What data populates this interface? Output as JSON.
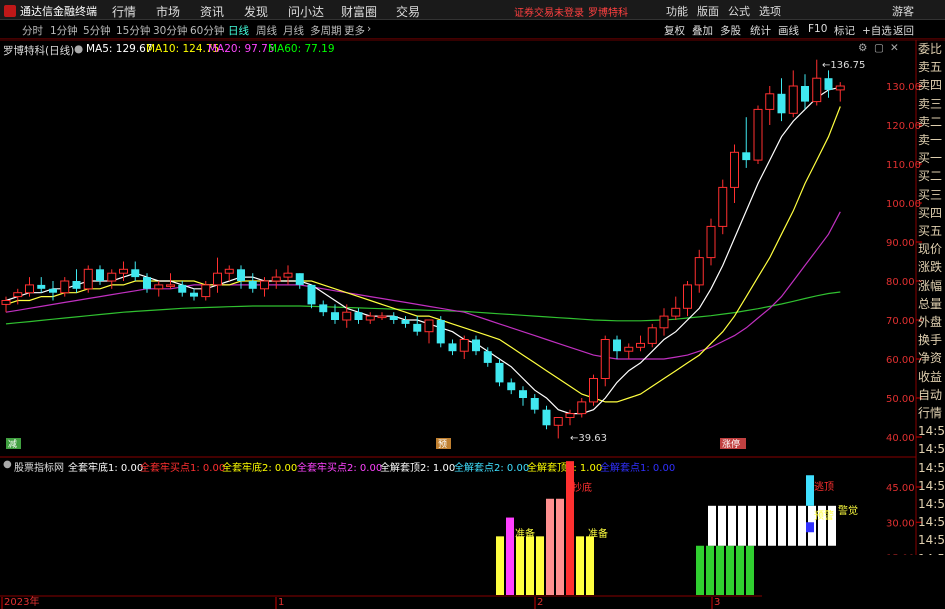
{
  "menubar": {
    "app_title": "通达信金融终端",
    "items": [
      "行情",
      "市场",
      "资讯",
      "发现",
      "问小达",
      "财富圈",
      "交易"
    ],
    "warning": "证券交易未登录",
    "stock": "罗博特科",
    "right_items": [
      "功能",
      "版面",
      "公式",
      "选项"
    ],
    "guest": "游客"
  },
  "periodbar": {
    "periods": [
      "分时",
      "1分钟",
      "5分钟",
      "15分钟",
      "30分钟",
      "60分钟",
      "日线",
      "周线",
      "月线",
      "多周期",
      "更多"
    ],
    "active": "日线",
    "tools": [
      "复权",
      "叠加",
      "多股",
      "统计",
      "画线",
      "F10",
      "标记",
      "+自选",
      "返回"
    ]
  },
  "info": {
    "title": "罗博特科(日线)",
    "ma5": "MA5: 129.67",
    "ma10": "MA10: 124.75",
    "ma20": "MA20: 97.75",
    "ma60": "MA60: 77.19",
    "colors": {
      "ma5": "#ffffff",
      "ma10": "#ffff00",
      "ma20": "#ff40ff",
      "ma60": "#00ff00"
    }
  },
  "right_panel": [
    "委比",
    "卖五",
    "卖四",
    "卖三",
    "卖二",
    "卖一",
    "买一",
    "买二",
    "买三",
    "买四",
    "买五",
    "现价",
    "涨跌",
    "涨幅",
    "总量",
    "外盘",
    "换手",
    "净资",
    "收益",
    "自动",
    "行情",
    "14:5",
    "14:5",
    "14:5",
    "14:5",
    "14:5",
    "14:5",
    "14:5",
    "14:5",
    "14:5",
    "14:5"
  ],
  "indicator": {
    "name": "股票指标网",
    "items": [
      {
        "text": "全套牢底1: 0.00",
        "color": "#ffffff"
      },
      {
        "text": "全套牢买点1: 0.00",
        "color": "#ff3030"
      },
      {
        "text": "全套牢底2: 0.00",
        "color": "#ffff00"
      },
      {
        "text": "全套牢买点2: 0.00",
        "color": "#ff40ff"
      },
      {
        "text": "全解套顶2: 1.00",
        "color": "#ffffff"
      },
      {
        "text": "全解套点2: 0.00",
        "color": "#40e0ff"
      },
      {
        "text": "全解套顶1: 1.00",
        "color": "#ffff00"
      },
      {
        "text": "全解套点1: 0.00",
        "color": "#3030ff"
      }
    ]
  },
  "chart_data": {
    "type": "candlestick",
    "price_ticks": [
      "130.00",
      "120.00",
      "110.00",
      "100.00",
      "90.00",
      "80.00",
      "70.00",
      "60.00",
      "50.00",
      "40.00"
    ],
    "high_label": "136.75",
    "low_label": "39.63",
    "ind_ticks": [
      "45.00",
      "30.00",
      "15.00"
    ],
    "x_labels": [
      "2023年",
      "1",
      "2",
      "3"
    ],
    "markers": [
      "减",
      "预",
      "涨停"
    ],
    "ind_labels": [
      "抄底",
      "准备",
      "准备",
      "逃顶",
      "预警",
      "警觉"
    ],
    "candles": [
      [
        74,
        76,
        72,
        75
      ],
      [
        76,
        78,
        74,
        77
      ],
      [
        77,
        81,
        76,
        79
      ],
      [
        79,
        81,
        77,
        78
      ],
      [
        78,
        80,
        75,
        77
      ],
      [
        77,
        81,
        76,
        80
      ],
      [
        80,
        83,
        77,
        78
      ],
      [
        78,
        84,
        77,
        83
      ],
      [
        83,
        84,
        79,
        80
      ],
      [
        80,
        83,
        78,
        82
      ],
      [
        82,
        85,
        80,
        83
      ],
      [
        83,
        85,
        80,
        81
      ],
      [
        81,
        82,
        77,
        78
      ],
      [
        78,
        80,
        76,
        79
      ],
      [
        79,
        82,
        78,
        79
      ],
      [
        79,
        80,
        76,
        77
      ],
      [
        77,
        78,
        75,
        76
      ],
      [
        76,
        80,
        75,
        79
      ],
      [
        79,
        86,
        77,
        82
      ],
      [
        82,
        84,
        80,
        83
      ],
      [
        83,
        84,
        78,
        80
      ],
      [
        80,
        82,
        77,
        78
      ],
      [
        78,
        81,
        76,
        80
      ],
      [
        80,
        83,
        78,
        81
      ],
      [
        81,
        84,
        79,
        82
      ],
      [
        82,
        82,
        78,
        79
      ],
      [
        79,
        79,
        73,
        74
      ],
      [
        74,
        75,
        71,
        72
      ],
      [
        72,
        74,
        69,
        70
      ],
      [
        70,
        74,
        68,
        72
      ],
      [
        72,
        73,
        69,
        70
      ],
      [
        70,
        72,
        69,
        71
      ],
      [
        71,
        72,
        70,
        71
      ],
      [
        71,
        72,
        69,
        70
      ],
      [
        70,
        71,
        68,
        69
      ],
      [
        69,
        71,
        66,
        67
      ],
      [
        67,
        68,
        64,
        70
      ],
      [
        70,
        71,
        63,
        64
      ],
      [
        64,
        65,
        61,
        62
      ],
      [
        62,
        66,
        60,
        65
      ],
      [
        65,
        66,
        61,
        62
      ],
      [
        62,
        63,
        58,
        59
      ],
      [
        59,
        60,
        53,
        54
      ],
      [
        54,
        55,
        51,
        52
      ],
      [
        52,
        53,
        48,
        50
      ],
      [
        50,
        51,
        46,
        47
      ],
      [
        47,
        48,
        42,
        43
      ],
      [
        43,
        45,
        39.63,
        45
      ],
      [
        45,
        47,
        43,
        46
      ],
      [
        46,
        50,
        45,
        49
      ],
      [
        49,
        56,
        48,
        55
      ],
      [
        55,
        66,
        53,
        65
      ],
      [
        65,
        66,
        60,
        62
      ],
      [
        62,
        64,
        60,
        63
      ],
      [
        63,
        66,
        62,
        64
      ],
      [
        64,
        69,
        63,
        68
      ],
      [
        68,
        73,
        66,
        71
      ],
      [
        71,
        76,
        70,
        73
      ],
      [
        73,
        80,
        71,
        79
      ],
      [
        79,
        88,
        77,
        86
      ],
      [
        86,
        96,
        84,
        94
      ],
      [
        94,
        106,
        92,
        104
      ],
      [
        104,
        115,
        100,
        113
      ],
      [
        113,
        122,
        109,
        111
      ],
      [
        111,
        125,
        110,
        124
      ],
      [
        124,
        130,
        120,
        128
      ],
      [
        128,
        132,
        121,
        123
      ],
      [
        123,
        134,
        122,
        130
      ],
      [
        130,
        133,
        124,
        126
      ],
      [
        126,
        136.75,
        125,
        132
      ],
      [
        132,
        134,
        127,
        129
      ],
      [
        129,
        131,
        126,
        130
      ]
    ],
    "ma5": [
      75,
      76,
      77,
      77,
      78,
      78,
      79,
      80,
      80,
      80,
      81,
      82,
      81,
      80,
      80,
      79,
      78,
      78,
      79,
      80,
      81,
      81,
      80,
      80,
      80,
      80,
      79,
      77,
      75,
      73,
      72,
      71,
      71,
      71,
      70,
      70,
      69,
      68,
      67,
      65,
      64,
      62,
      60,
      58,
      55,
      52,
      50,
      47,
      46,
      46,
      47,
      50,
      54,
      57,
      59,
      62,
      65,
      67,
      70,
      73,
      78,
      84,
      91,
      98,
      105,
      111,
      117,
      121,
      124,
      127,
      129,
      129.67
    ],
    "ma10": [
      74,
      75,
      75,
      76,
      76,
      77,
      77,
      78,
      78,
      79,
      79,
      80,
      80,
      80,
      80,
      80,
      80,
      79,
      79,
      79,
      80,
      80,
      80,
      80,
      80,
      80,
      80,
      79,
      78,
      77,
      76,
      75,
      74,
      73,
      72,
      71,
      71,
      70,
      69,
      68,
      67,
      66,
      65,
      63,
      61,
      59,
      57,
      55,
      53,
      51,
      50,
      49,
      49,
      50,
      51,
      53,
      55,
      57,
      59,
      61,
      64,
      67,
      71,
      76,
      81,
      86,
      92,
      98,
      105,
      111,
      117,
      124.75
    ],
    "ma20": [
      72,
      72.5,
      73,
      73.5,
      74,
      74.5,
      75,
      75.5,
      76,
      76.5,
      77,
      77.5,
      78,
      78,
      78,
      78.5,
      79,
      79,
      79,
      79,
      79,
      79,
      79,
      79,
      79,
      79,
      78.5,
      78,
      77.5,
      77,
      76.5,
      76,
      75.5,
      75,
      74.5,
      74,
      73.5,
      73,
      72.5,
      72,
      71,
      70,
      69,
      68,
      67,
      66,
      65,
      64,
      63,
      62,
      61,
      60.5,
      60,
      60,
      60,
      60,
      60,
      60.5,
      61,
      62,
      63,
      64.5,
      66,
      68,
      70.5,
      73,
      76,
      80,
      84,
      88,
      92,
      97.75
    ],
    "ma60": [
      69,
      69.3,
      69.6,
      69.9,
      70.2,
      70.5,
      70.8,
      71.1,
      71.4,
      71.7,
      72,
      72.2,
      72.4,
      72.6,
      72.8,
      73,
      73.1,
      73.2,
      73.3,
      73.4,
      73.5,
      73.6,
      73.6,
      73.6,
      73.6,
      73.6,
      73.5,
      73.4,
      73.3,
      73.2,
      73.1,
      73,
      72.9,
      72.8,
      72.7,
      72.6,
      72.5,
      72.4,
      72.3,
      72.2,
      72,
      71.8,
      71.6,
      71.4,
      71.2,
      71,
      70.8,
      70.6,
      70.4,
      70.2,
      70,
      69.9,
      69.8,
      69.8,
      69.8,
      69.9,
      70,
      70.2,
      70.5,
      70.8,
      71.1,
      71.5,
      71.9,
      72.4,
      72.9,
      73.5,
      74.1,
      74.8,
      75.5,
      76.2,
      76.8,
      77.19
    ]
  }
}
